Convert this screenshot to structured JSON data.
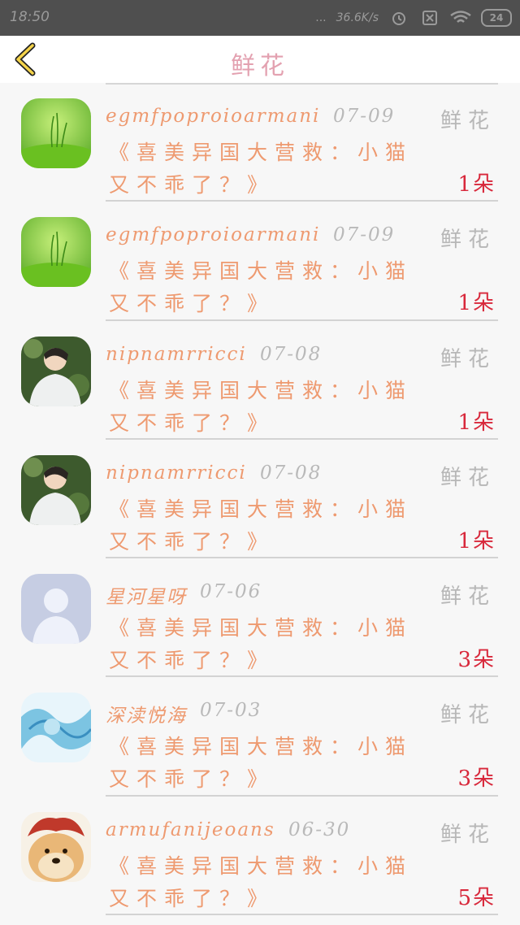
{
  "status_bar": {
    "time": "18:50",
    "signal_dots": "...",
    "net_speed": "36.6K/s",
    "battery": "24"
  },
  "header": {
    "back_icon": "chevron-left-icon",
    "title": "鲜花"
  },
  "colors": {
    "accent_orange": "#ee9a70",
    "title_pink": "#e3a1b0",
    "count_red": "#d8283b",
    "gray_text": "#b9b9b9"
  },
  "records": [
    {
      "username": "egmfpoproioarmani",
      "date": "07-09",
      "gift": "鲜花",
      "message": "《喜美异国大营救：小猫又不乖了？》",
      "count": "1朵",
      "avatar": "green-grass-avatar"
    },
    {
      "username": "egmfpoproioarmani",
      "date": "07-09",
      "gift": "鲜花",
      "message": "《喜美异国大营救：小猫又不乖了？》",
      "count": "1朵",
      "avatar": "green-grass-avatar"
    },
    {
      "username": "nipnamrricci",
      "date": "07-08",
      "gift": "鲜花",
      "message": "《喜美异国大营救：小猫又不乖了？》",
      "count": "1朵",
      "avatar": "boy-photo-avatar"
    },
    {
      "username": "nipnamrricci",
      "date": "07-08",
      "gift": "鲜花",
      "message": "《喜美异国大营救：小猫又不乖了？》",
      "count": "1朵",
      "avatar": "boy-photo-avatar"
    },
    {
      "username": "星河星呀",
      "date": "07-06",
      "gift": "鲜花",
      "message": "《喜美异国大营救：小猫又不乖了？》",
      "count": "3朵",
      "avatar": "default-user-avatar"
    },
    {
      "username": "深渎悦海",
      "date": "07-03",
      "gift": "鲜花",
      "message": "《喜美异国大营救：小猫又不乖了？》",
      "count": "3朵",
      "avatar": "blue-anime-avatar"
    },
    {
      "username": "armufanijeoans",
      "date": "06-30",
      "gift": "鲜花",
      "message": "《喜美异国大营救：小猫又不乖了？》",
      "count": "5朵",
      "avatar": "doge-avatar"
    }
  ]
}
